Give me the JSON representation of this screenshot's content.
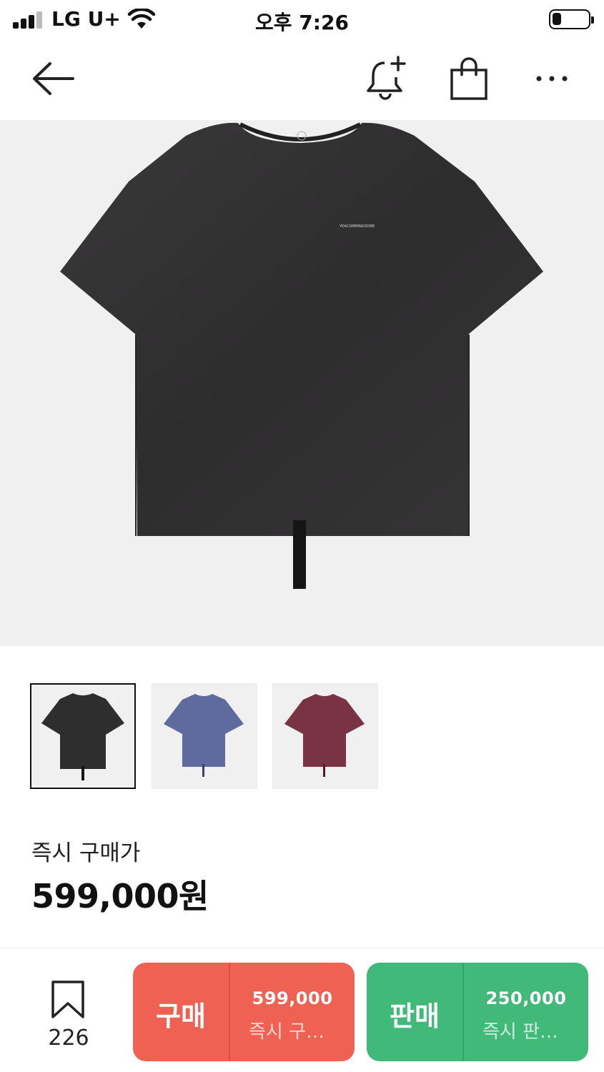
{
  "status_bar": {
    "carrier": "LG U+",
    "time": "오후 7:26",
    "battery_level": 0.25
  },
  "nav": {
    "icons": [
      "back-arrow-icon",
      "bell-plus-icon",
      "shopping-bag-icon",
      "more-dots-icon"
    ]
  },
  "product": {
    "hero_print_text": "YEACOMMINGSOME",
    "thumbnails": [
      {
        "name": "black",
        "color": "#2f2e2f",
        "selected": true
      },
      {
        "name": "blue",
        "color": "#5f6a9e",
        "selected": false
      },
      {
        "name": "burgundy",
        "color": "#7a3344",
        "selected": false
      }
    ],
    "price_label": "즉시 구매가",
    "price_value": "599,000원"
  },
  "bottom_bar": {
    "wish_count": "226",
    "buy": {
      "label": "구매",
      "price": "599,000",
      "sub": "즉시 구매가",
      "color": "#ef6253"
    },
    "sell": {
      "label": "판매",
      "price": "250,000",
      "sub": "즉시 판매가",
      "color": "#41b979"
    }
  }
}
